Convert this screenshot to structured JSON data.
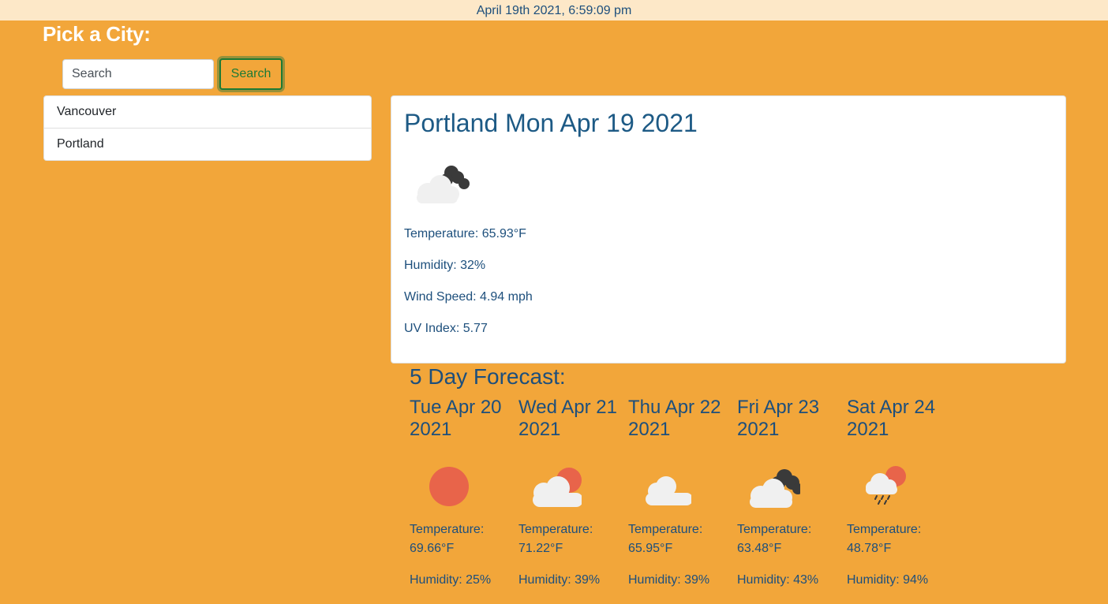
{
  "header": {
    "datetime": "April 19th 2021, 6:59:09 pm"
  },
  "sidebar": {
    "title": "Pick a City:",
    "search_placeholder": "Search",
    "search_button": "Search",
    "cities": [
      "Vancouver",
      "Portland"
    ]
  },
  "current": {
    "title": "Portland Mon Apr 19 2021",
    "icon": "partly-cloudy-dark-cloud-icon",
    "temperature": "Temperature: 65.93°F",
    "humidity": "Humidity: 32%",
    "wind": "Wind Speed: 4.94 mph",
    "uv": "UV Index: 5.77"
  },
  "forecast": {
    "title": "5 Day Forecast:",
    "days": [
      {
        "date": "Tue Apr 20 2021",
        "icon": "sun-icon",
        "temp_label": "Temperature:",
        "temp": "69.66°F",
        "humidity": "Humidity: 25%"
      },
      {
        "date": "Wed Apr 21 2021",
        "icon": "cloud-sun-icon",
        "temp_label": "Temperature:",
        "temp": "71.22°F",
        "humidity": "Humidity: 39%"
      },
      {
        "date": "Thu Apr 22 2021",
        "icon": "cloud-icon",
        "temp_label": "Temperature:",
        "temp": "65.95°F",
        "humidity": "Humidity: 39%"
      },
      {
        "date": "Fri Apr 23 2021",
        "icon": "dark-clouds-icon",
        "temp_label": "Temperature:",
        "temp": "63.48°F",
        "humidity": "Humidity: 43%"
      },
      {
        "date": "Sat Apr 24 2021",
        "icon": "rain-sun-icon",
        "temp_label": "Temperature:",
        "temp": "48.78°F",
        "humidity": "Humidity: 94%"
      }
    ]
  },
  "colors": {
    "background": "#f2a63a",
    "topbar": "#fde8c8",
    "text_blue": "#1d4f7c",
    "button_green": "#1e7a34",
    "sun": "#e8644a"
  }
}
